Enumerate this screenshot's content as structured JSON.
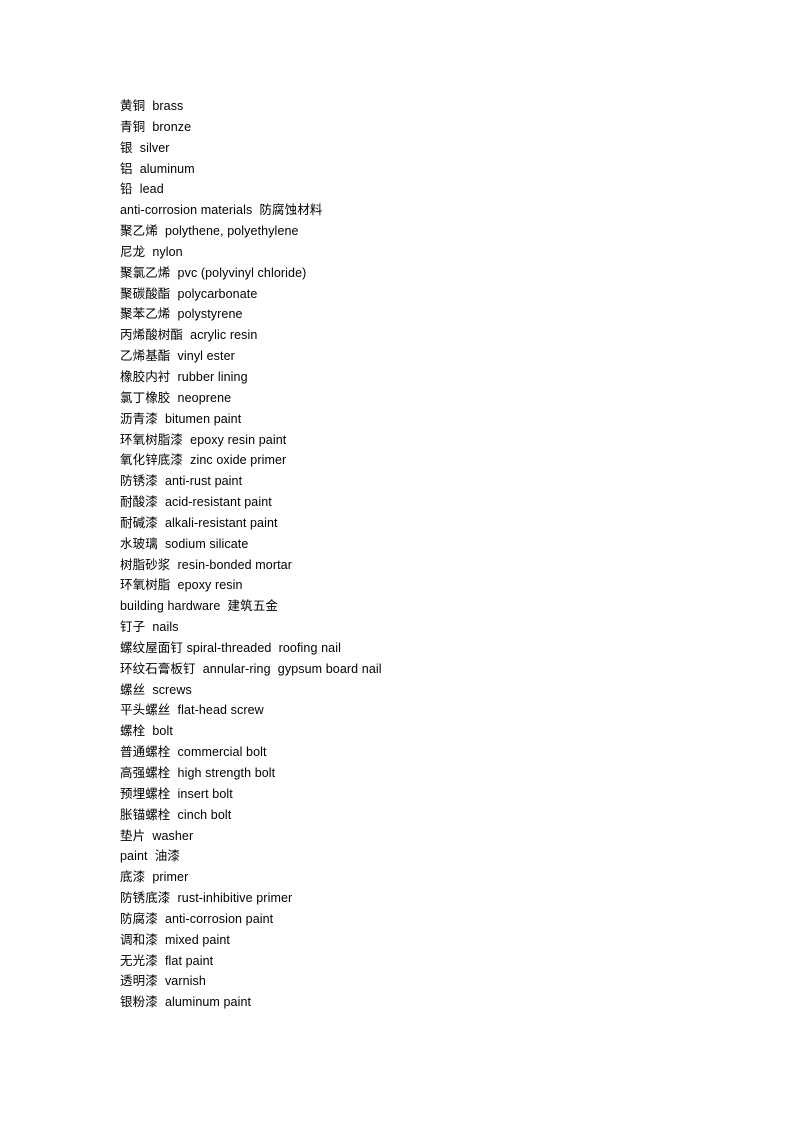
{
  "document": {
    "lines": [
      "黄铜  brass",
      "青铜  bronze",
      "银  silver",
      "铝  aluminum",
      "铅  lead",
      "anti-corrosion materials  防腐蚀材料",
      "聚乙烯  polythene, polyethylene",
      "尼龙  nylon",
      "聚氯乙烯  pvc (polyvinyl chloride)",
      "聚碳酸酯  polycarbonate",
      "聚苯乙烯  polystyrene",
      "丙烯酸树酯  acrylic resin",
      "乙烯基酯  vinyl ester",
      "橡胶内衬  rubber lining",
      "氯丁橡胶  neoprene",
      "沥青漆  bitumen paint",
      "环氧树脂漆  epoxy resin paint",
      "氧化锌底漆  zinc oxide primer",
      "防锈漆  anti-rust paint",
      "耐酸漆  acid-resistant paint",
      "耐碱漆  alkali-resistant paint",
      "水玻璃  sodium silicate",
      "树脂砂浆  resin-bonded mortar",
      "环氧树脂  epoxy resin",
      "building hardware  建筑五金",
      "钉子  nails",
      "螺纹屋面钉 spiral-threaded  roofing nail",
      "环纹石膏板钉  annular-ring  gypsum board nail",
      "螺丝  screws",
      "平头螺丝  flat-head screw",
      "螺栓  bolt",
      "普通螺栓  commercial bolt",
      "高强螺栓  high strength bolt",
      "预埋螺栓  insert bolt",
      "胀锚螺栓  cinch bolt",
      "垫片  washer",
      "paint  油漆",
      "底漆  primer",
      "防锈底漆  rust-inhibitive primer",
      "防腐漆  anti-corrosion paint",
      "调和漆  mixed paint",
      "无光漆  flat paint",
      "透明漆  varnish",
      "银粉漆  aluminum paint"
    ]
  }
}
